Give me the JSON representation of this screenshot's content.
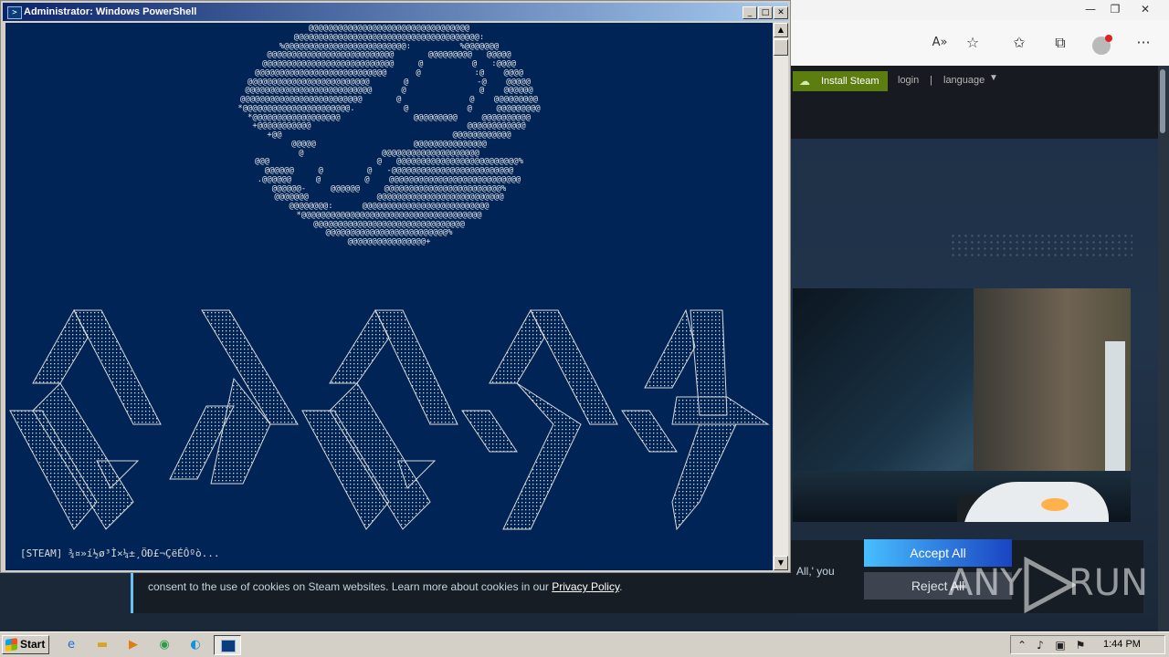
{
  "browser": {
    "toolbar_icons": [
      "read-aloud-icon",
      "add-favorite-icon",
      "favorites-icon",
      "collections-icon",
      "profile-icon",
      "more-icon"
    ],
    "window_controls": [
      "minimize",
      "restore",
      "close"
    ]
  },
  "steam": {
    "install_label": "Install Steam",
    "login_label": "login",
    "separator": "|",
    "language_label": "language",
    "cookie": {
      "text_line1_tail": "All,' you",
      "text_line2": "consent to the use of cookies on Steam websites. Learn more about cookies in our ",
      "privacy_link": "Privacy Policy",
      "text_line2_end": ".",
      "accept_label": "Accept All",
      "reject_label": "Reject All"
    }
  },
  "watermark": {
    "text_left": "ANY",
    "text_right": "RUN"
  },
  "powershell": {
    "title": "Administrator: Windows PowerShell",
    "ascii_art": [
      "@@@@@@@@@@@@@@@@@@@@@@@@@@@@@@@@@",
      "@@@@@@@@@@@@@@@@@@@@@@@@@@@@@@@@@@@@@@:",
      "%@@@@@@@@@@@@@@@@@@@@@@@@@:          %@@@@@@@",
      "@@@@@@@@@@@@@@@@@@@@@@@@@@       @@@@@@@@@   @@@@@",
      "@@@@@@@@@@@@@@@@@@@@@@@@@@@     @          @   :@@@@",
      "@@@@@@@@@@@@@@@@@@@@@@@@@@@      @           :@    @@@@",
      "@@@@@@@@@@@@@@@@@@@@@@@@@       @              -@    @@@@@",
      "@@@@@@@@@@@@@@@@@@@@@@@@@@      @               @    @@@@@@",
      "@@@@@@@@@@@@@@@@@@@@@@@@@       @              @    @@@@@@@@@",
      "*@@@@@@@@@@@@@@@@@@@@@@.          @            @     @@@@@@@@@",
      "*@@@@@@@@@@@@@@@@@@               @@@@@@@@@     @@@@@@@@@@",
      "+@@@@@@@@@@@                                @@@@@@@@@@@@",
      "+@@                                   @@@@@@@@@@@@",
      "@@@@@                    @@@@@@@@@@@@@@@",
      "@                @@@@@@@@@@@@@@@@@@@@",
      "@@@                      @   @@@@@@@@@@@@@@@@@@@@@@@@@%",
      "@@@@@@     @         @   -@@@@@@@@@@@@@@@@@@@@@@@@@",
      ".@@@@@@     @         @    @@@@@@@@@@@@@@@@@@@@@@@@@@@",
      "@@@@@@-     @@@@@@     @@@@@@@@@@@@@@@@@@@@@@@@%",
      "@@@@@@@              @@@@@@@@@@@@@@@@@@@@@@@@@@",
      "@@@@@@@@:      @@@@@@@@@@@@@@@@@@@@@@@@@@",
      "*@@@@@@@@@@@@@@@@@@@@@@@@@@@@@@@@@@@@@",
      "@@@@@@@@@@@@@@@@@@@@@@@@@@@@@@@",
      "@@@@@@@@@@@@@@@@@@@@@@@@@%",
      "@@@@@@@@@@@@@@@@+"
    ],
    "status_line": "[STEAM] ¾¤»í½ø³Ì×¼±¸ÖÐ£¬ÇëÉÔºò..."
  },
  "taskbar": {
    "start_label": "Start",
    "quick_launch": [
      "ie-icon",
      "explorer-icon",
      "media-player-icon",
      "chrome-icon",
      "edge-icon"
    ],
    "clock": "1:44 PM"
  },
  "colors": {
    "console_bg": "#012456",
    "steam_green": "#5c7e10",
    "accept_gradient_start": "#47bfff",
    "accept_gradient_end": "#1a44c2"
  }
}
